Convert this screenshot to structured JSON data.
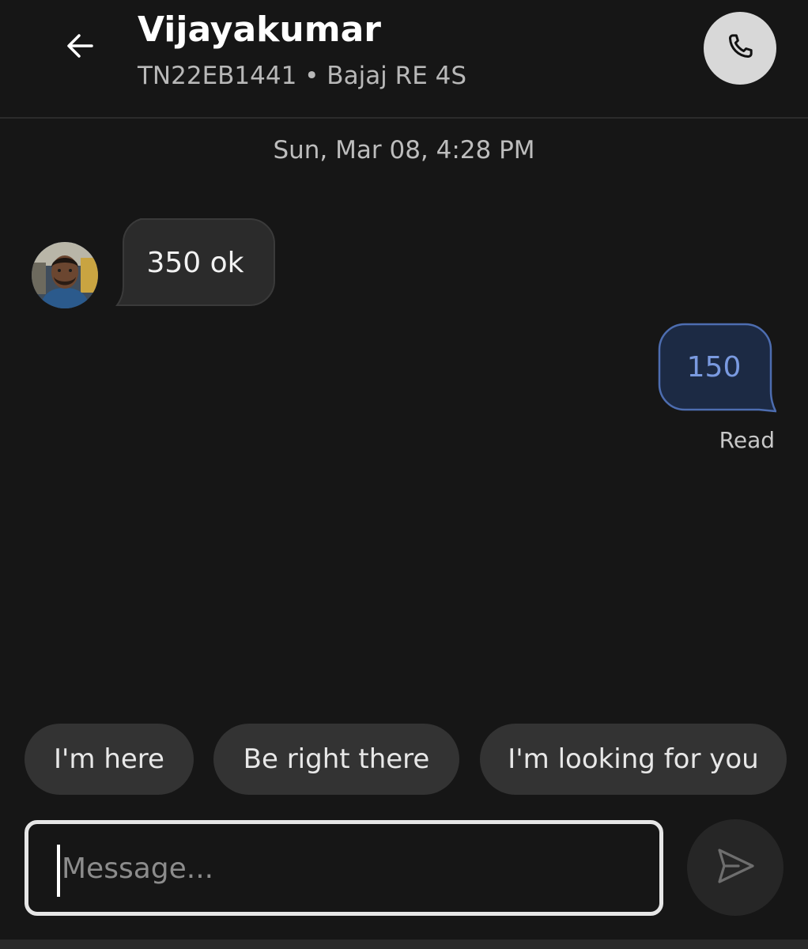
{
  "header": {
    "contact_name": "Vijayakumar",
    "vehicle_info": "TN22EB1441 • Bajaj RE 4S",
    "back_icon": "arrow-left-icon",
    "call_icon": "phone-icon"
  },
  "conversation": {
    "timestamp": "Sun, Mar 08, 4:28 PM",
    "messages": [
      {
        "direction": "incoming",
        "text": "350 ok"
      },
      {
        "direction": "outgoing",
        "text": "150",
        "status": "Read"
      }
    ]
  },
  "quick_replies": [
    "I'm here",
    "Be right there",
    "I'm looking for you"
  ],
  "composer": {
    "placeholder": "Message...",
    "value": "",
    "send_icon": "send-icon"
  },
  "colors": {
    "background": "#161616",
    "incoming_bubble": "#2b2b2b",
    "outgoing_bubble": "#1c2a44",
    "outgoing_text": "#7a9ae0",
    "chip": "#333333"
  }
}
